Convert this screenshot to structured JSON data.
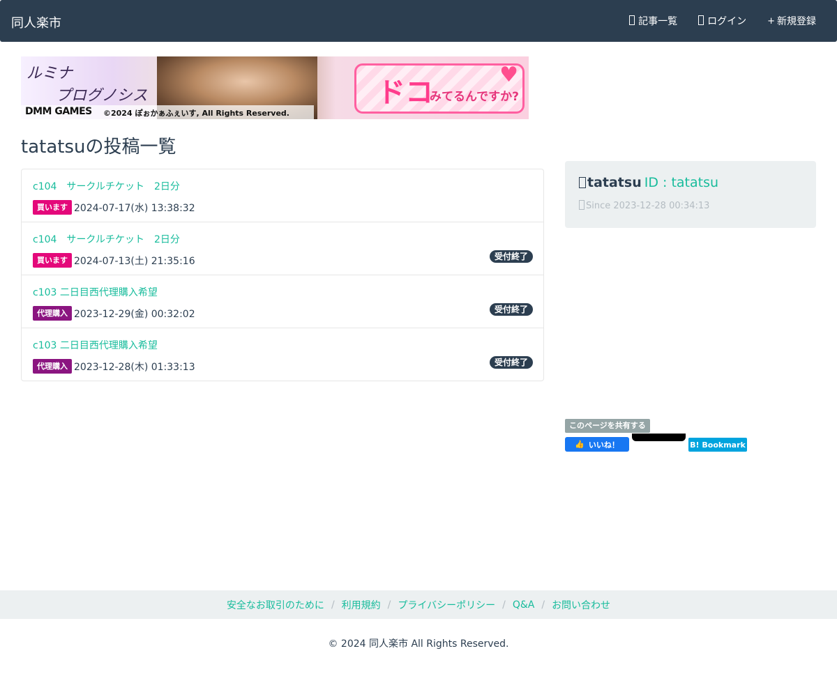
{
  "nav": {
    "brand": "同人楽市",
    "items": [
      {
        "icon": "",
        "label": "記事一覧"
      },
      {
        "icon": "",
        "label": "ログイン"
      },
      {
        "icon": "+",
        "label": "新規登録"
      }
    ]
  },
  "banner": {
    "title_line1": "ルミナ",
    "title_line2": "プログノシス",
    "publisher": "DMM GAMES",
    "copyright": "©2024 ぽぉかぁふぇいす, All Rights Reserved.",
    "bubble_big": "ドコ",
    "bubble_small": "みてるんですか?"
  },
  "page": {
    "title": "tatatsuの投稿一覧"
  },
  "posts": [
    {
      "title": "c104　サークルチケット　2日分",
      "tag": "買います",
      "date": "2024-07-17(水) 13:38:32",
      "status": ""
    },
    {
      "title": "c104　サークルチケット　2日分",
      "tag": "買います",
      "date": "2024-07-13(土) 21:35:16",
      "status": "受付終了"
    },
    {
      "title": "c103 二日目西代理購入希望",
      "tag": "代理購入",
      "date": "2023-12-29(金) 00:32:02",
      "status": "受付終了"
    },
    {
      "title": "c103 二日目西代理購入希望",
      "tag": "代理購入",
      "date": "2023-12-28(木) 01:33:13",
      "status": "受付終了"
    }
  ],
  "profile": {
    "username": "tatatsu",
    "id_text": "ID : tatatsu",
    "since": "Since 2023-12-28 00:34:13"
  },
  "share": {
    "label": "このページを共有する",
    "fb_label": "いいね！",
    "hatena_label": "B! Bookmark"
  },
  "footer": {
    "links": [
      "安全なお取引のために",
      "利用規約",
      "プライバシーポリシー",
      "Q&A",
      "お問い合わせ"
    ],
    "copyright": "© 2024 同人楽市 All Rights Reserved."
  },
  "colors": {
    "navbar": "#2c3e50",
    "accent": "#18bc9c",
    "tag_buy": "#e4087a",
    "tag_proxy": "#8b1580"
  }
}
